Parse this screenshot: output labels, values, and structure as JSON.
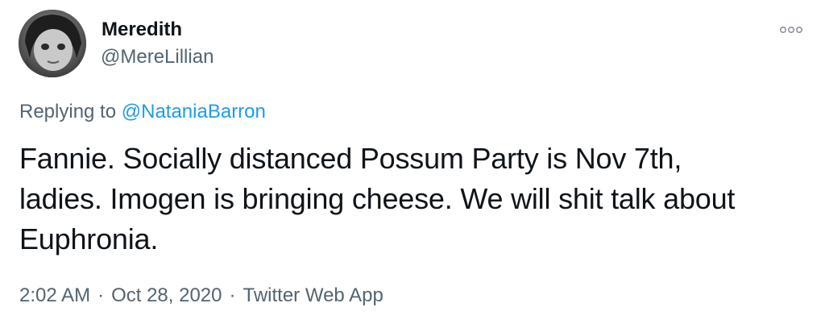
{
  "author": {
    "display_name": "Meredith",
    "handle": "@MereLillian"
  },
  "reply": {
    "prefix": "Replying to",
    "mention": "@NataniaBarron"
  },
  "tweet": {
    "lines": [
      "Fannie. Socially distanced Possum Party is Nov 7th,",
      "ladies. Imogen is bringing cheese. We will shit talk about",
      "Euphronia."
    ]
  },
  "meta": {
    "time": "2:02 AM",
    "separator": "·",
    "date": "Oct 28, 2020",
    "source": "Twitter Web App"
  },
  "icons": {
    "more": "more-horizontal-icon"
  },
  "colors": {
    "text": "#0f1419",
    "secondary": "#536471",
    "link": "#1d9bf0"
  }
}
